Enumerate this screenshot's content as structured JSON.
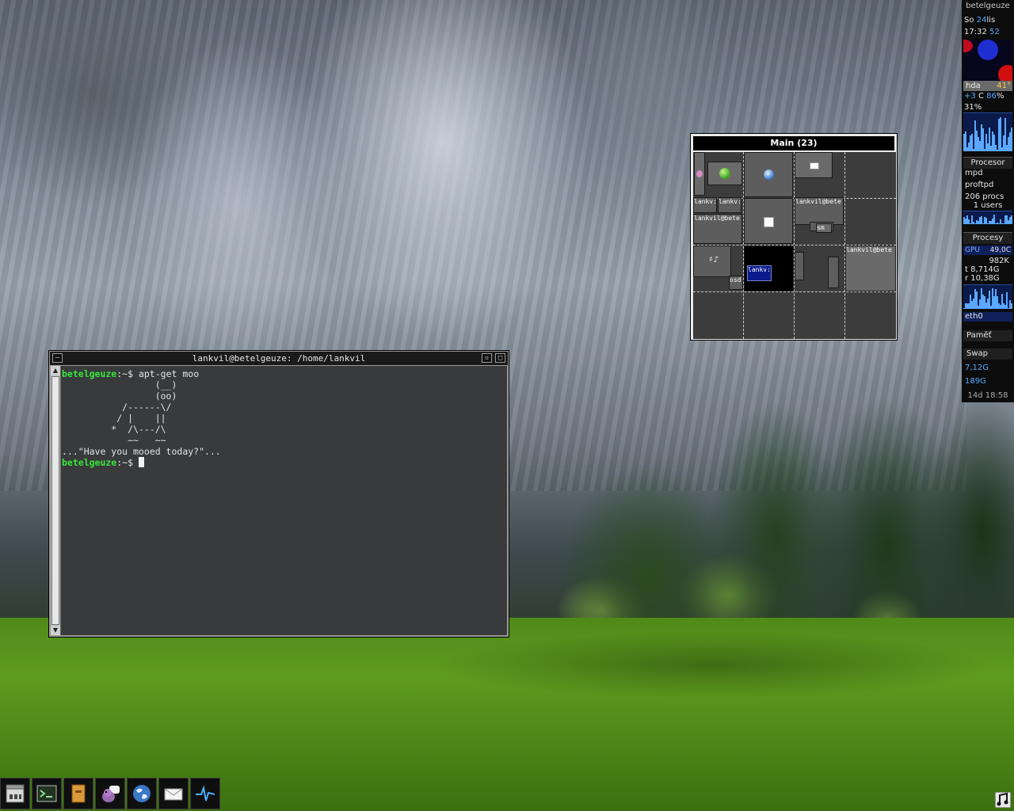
{
  "terminal": {
    "title": "lankvil@betelgeuze: /home/lankvil",
    "menu_button": "—",
    "iconify_button": "▫",
    "maximize_button": "□",
    "prompt_host": "betelgeuze",
    "prompt_suffix": ":~$",
    "command": " apt-get moo",
    "cow_art": "                 (__)\n                 (oo)\n           /------\\/\n          / |    ||\n         *  /\\---/\\\n            ~~   ~~\n",
    "cow_message": "...\"Have you mooed today?\"...",
    "second_prompt_host": "betelgeuze",
    "second_prompt_suffix": ":~$ "
  },
  "pager": {
    "title": "Main (23)",
    "window_labels": {
      "w1": "lankv:",
      "w2": "lankv:",
      "w3": "lankvil@bete",
      "w4": "lankvil@bete",
      "w5": "lankv:",
      "w6": "lankvil@bete",
      "w7": "osd",
      "w8": "sm"
    }
  },
  "conky": {
    "hostname": "betelgeuze",
    "day_name": "So",
    "day_num": "24",
    "month": "lis",
    "time_hm": "17:32",
    "time_s": "52",
    "hda_label": "hda",
    "hda_temp": "41°",
    "cpu_freq_delta": "+3",
    "cpu_temp_label": "C",
    "cpu_temp": "86",
    "cpu_temp_unit": "%",
    "cpu_usage": "31%",
    "section_cpu": "Procesor",
    "proc_1": "mpd",
    "proc_2": "proftpd",
    "procs": "206 procs",
    "users": "1 users",
    "section_proc": "Procesy",
    "gpu_label": "GPU",
    "gpu_temp": "49,0C",
    "mem_1": "982K",
    "mem_2": "t 8,714G",
    "mem_3": "r 10,38G",
    "net_label": "eth0",
    "section_mem": "Paměť",
    "section_swap": "Swap",
    "disk_1": "7,12G",
    "disk_2": "189G",
    "uptime": "14d 18:58",
    "colors": {
      "accent": "#55aaff",
      "hot": "#d01010",
      "panel": "#0c0c0c"
    }
  },
  "dock": {
    "items": [
      {
        "name": "file-cabinet-icon"
      },
      {
        "name": "terminal-icon"
      },
      {
        "name": "folder-icon"
      },
      {
        "name": "pidgin-icon"
      },
      {
        "name": "browser-globe-icon"
      },
      {
        "name": "mail-icon"
      },
      {
        "name": "audio-wave-icon"
      }
    ]
  },
  "tray": {
    "icon": "music-note-icon"
  }
}
